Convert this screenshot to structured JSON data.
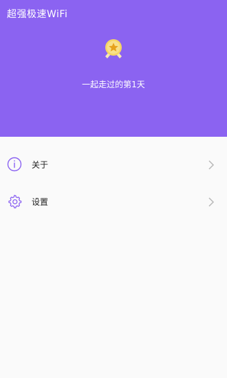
{
  "header": {
    "app_title": "超强极速WiFi",
    "days_text": "一起走过的第1天",
    "background_color": "#8b63f1"
  },
  "menu": {
    "items": [
      {
        "label": "关于",
        "icon": "info-icon"
      },
      {
        "label": "设置",
        "icon": "gear-icon"
      }
    ]
  },
  "colors": {
    "icon_accent": "#8b63f1",
    "badge_gold": "#f5c73a",
    "chevron": "#b8b8b8"
  }
}
